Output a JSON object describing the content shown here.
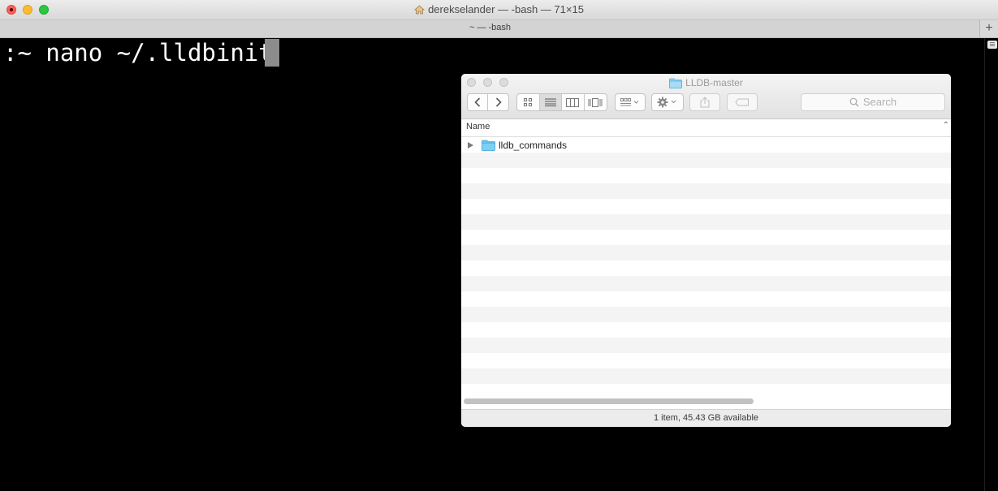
{
  "terminal": {
    "window_title": "derekselander — -bash — 71×15",
    "tab_title": "~ — -bash",
    "command_line": ":~ nano ~/.lldbinit",
    "new_tab_label": "+"
  },
  "finder": {
    "window_title": "LLDB-master",
    "search_placeholder": "Search",
    "column_header": "Name",
    "items": [
      {
        "name": "lldb_commands",
        "kind": "folder",
        "expanded": false
      }
    ],
    "status_text": "1 item, 45.43 GB available",
    "view_mode": "list"
  },
  "colors": {
    "terminal_bg": "#000000",
    "terminal_text": "#ffffff",
    "folder_blue": "#6cc4f0",
    "close_red": "#fc5f57",
    "minimize_yellow": "#fdbc2e",
    "zoom_green": "#28c840"
  }
}
